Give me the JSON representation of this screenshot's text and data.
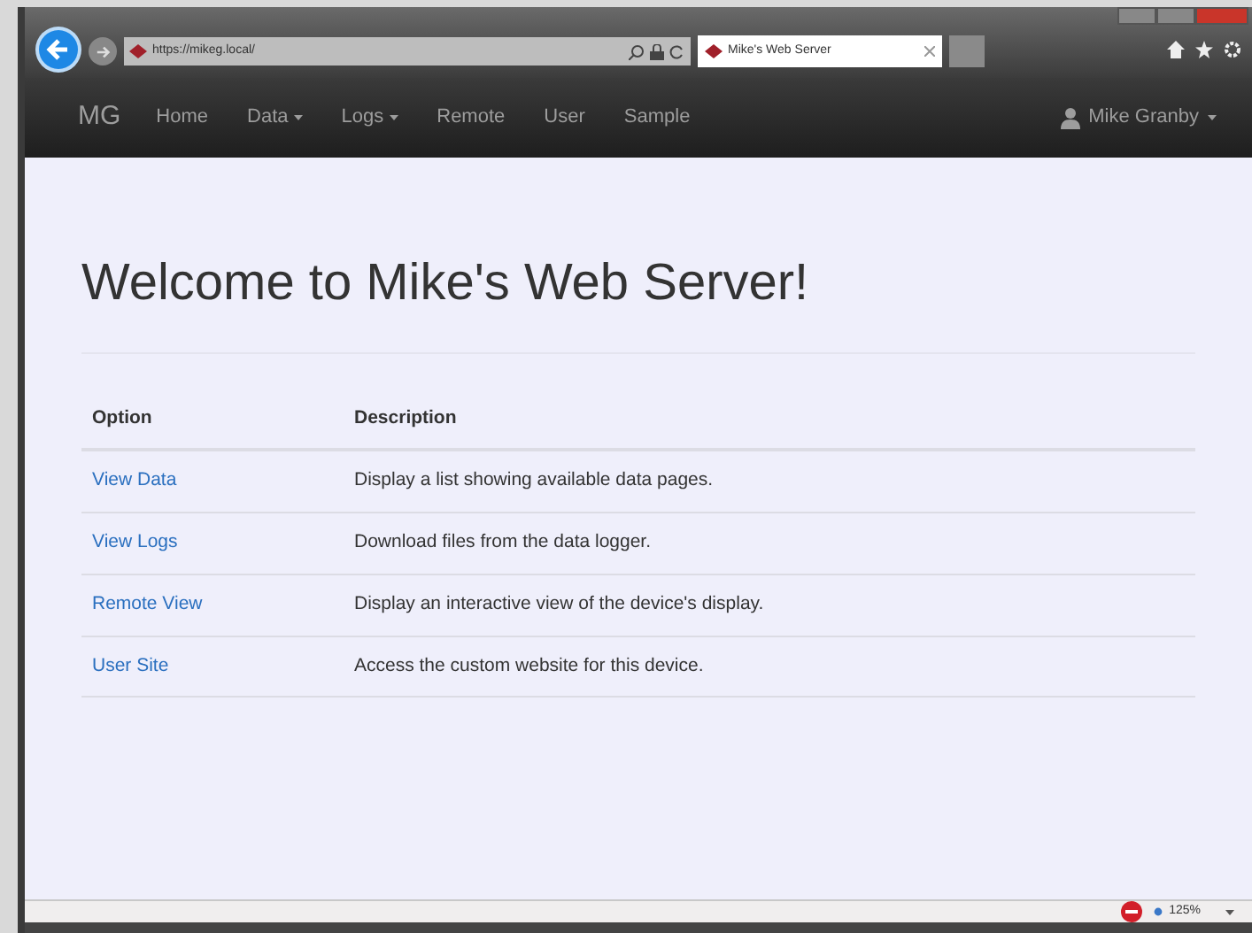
{
  "browser": {
    "address": "https://mikeg.local/",
    "tab_title": "Mike's Web Server",
    "zoom": "125%"
  },
  "navbar": {
    "brand": "MG",
    "items": [
      {
        "label": "Home",
        "dropdown": false
      },
      {
        "label": "Data",
        "dropdown": true
      },
      {
        "label": "Logs",
        "dropdown": true
      },
      {
        "label": "Remote",
        "dropdown": false
      },
      {
        "label": "User",
        "dropdown": false
      },
      {
        "label": "Sample",
        "dropdown": false
      }
    ],
    "user": "Mike Granby"
  },
  "heading": "Welcome to Mike's Web Server!",
  "table": {
    "columns": [
      "Option",
      "Description"
    ],
    "rows": [
      {
        "option": "View Data",
        "description": "Display a list showing available data pages."
      },
      {
        "option": "View Logs",
        "description": "Download files from the data logger."
      },
      {
        "option": "Remote View",
        "description": "Display an interactive view of the device's display."
      },
      {
        "option": "User Site",
        "description": "Access the custom website for this device."
      }
    ]
  }
}
